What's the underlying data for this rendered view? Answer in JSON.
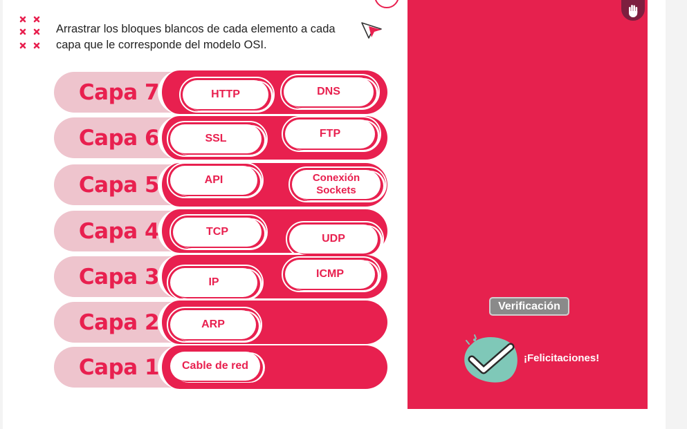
{
  "instruction": "Arrastrar los bloques blancos de cada elemento a cada capa que le corresponde del modelo OSI.",
  "colors": {
    "accent": "#e8204f",
    "label_bg": "#eec4cd",
    "panel": "#e6214e",
    "teal": "#7fc8b8"
  },
  "layers": [
    {
      "label": "Capa 7",
      "blocks": [
        "HTTP",
        "DNS"
      ]
    },
    {
      "label": "Capa 6",
      "blocks": [
        "SSL",
        "FTP"
      ]
    },
    {
      "label": "Capa 5",
      "blocks": [
        "API",
        "Conexión Sockets"
      ]
    },
    {
      "label": "Capa 4",
      "blocks": [
        "TCP",
        "UDP"
      ]
    },
    {
      "label": "Capa 3",
      "blocks": [
        "IP",
        "ICMP"
      ]
    },
    {
      "label": "Capa 2",
      "blocks": [
        "ARP"
      ]
    },
    {
      "label": "Capa 1",
      "blocks": [
        "Cable de red"
      ]
    }
  ],
  "verify_button": "Verificación",
  "feedback": "¡Felicitaciones!",
  "icons": {
    "hand": "hand-icon",
    "cursor": "cursor-icon",
    "check": "check-icon",
    "dots": "x-dots-icon"
  }
}
